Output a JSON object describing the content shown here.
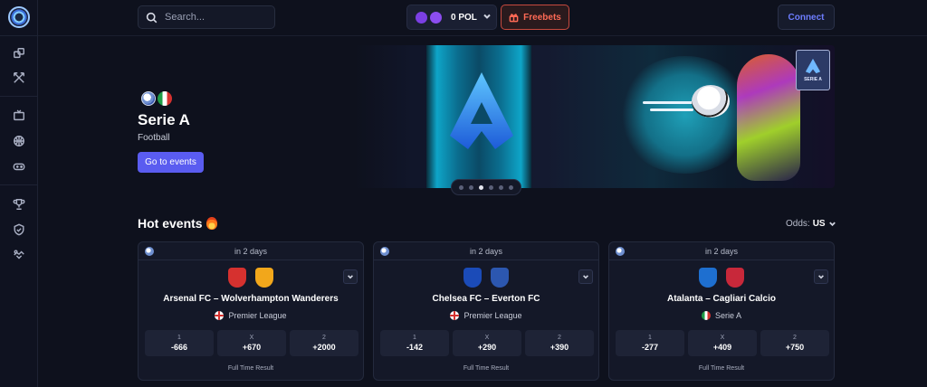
{
  "search": {
    "placeholder": "Search..."
  },
  "header": {
    "balance": "0 POL",
    "freebets_label": "Freebets",
    "connect_label": "Connect"
  },
  "sidebar": {
    "icons": [
      "dice-icon",
      "swords-icon",
      "tv-icon",
      "basketball-icon",
      "gamepad-icon",
      "trophy-icon",
      "shield-icon",
      "handshake-icon"
    ]
  },
  "hero": {
    "title": "Serie A",
    "subtitle": "Football",
    "button_label": "Go to events",
    "badge_label": "SERIE A",
    "carousel": {
      "count": 6,
      "active_index": 2
    }
  },
  "hot_events": {
    "title": "Hot events",
    "odds_label": "Odds:",
    "odds_format": "US"
  },
  "events": [
    {
      "time": "in 2 days",
      "match": "Arsenal FC – Wolverhampton Wanderers",
      "league": "Premier League",
      "league_flag": "england",
      "home_color": "#d6312f",
      "away_color": "#f2a71b",
      "odds": [
        {
          "label": "1",
          "value": "-666"
        },
        {
          "label": "X",
          "value": "+670"
        },
        {
          "label": "2",
          "value": "+2000"
        }
      ],
      "market": "Full Time Result"
    },
    {
      "time": "in 2 days",
      "match": "Chelsea FC – Everton FC",
      "league": "Premier League",
      "league_flag": "england",
      "home_color": "#1b4bb8",
      "away_color": "#2c57b0",
      "odds": [
        {
          "label": "1",
          "value": "-142"
        },
        {
          "label": "X",
          "value": "+290"
        },
        {
          "label": "2",
          "value": "+390"
        }
      ],
      "market": "Full Time Result"
    },
    {
      "time": "in 2 days",
      "match": "Atalanta – Cagliari Calcio",
      "league": "Serie A",
      "league_flag": "italy",
      "home_color": "#1e6fd0",
      "away_color": "#c8283a",
      "odds": [
        {
          "label": "1",
          "value": "-277"
        },
        {
          "label": "X",
          "value": "+409"
        },
        {
          "label": "2",
          "value": "+750"
        }
      ],
      "market": "Full Time Result"
    }
  ]
}
